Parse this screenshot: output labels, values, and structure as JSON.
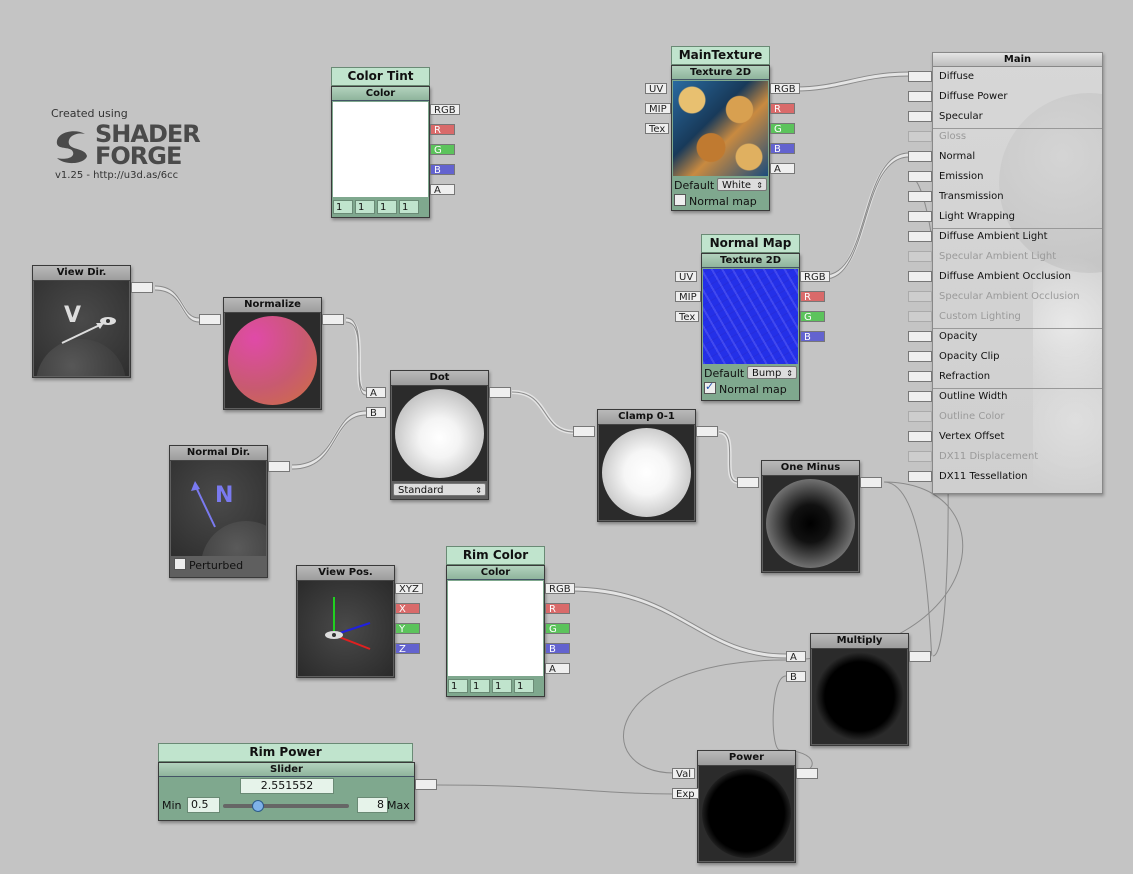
{
  "logo": {
    "created": "Created using",
    "brand_top": "SHADER",
    "brand_bottom": "FORGE",
    "version": "v1.25 - http://u3d.as/6cc"
  },
  "nodes": {
    "color_tint": {
      "title": "Color Tint",
      "sub": "Color",
      "ports": [
        "RGB",
        "R",
        "G",
        "B",
        "A"
      ],
      "values": [
        "1",
        "1",
        "1",
        "1"
      ]
    },
    "main_texture": {
      "title": "MainTexture",
      "sub": "Texture 2D",
      "inputs": [
        "UV",
        "MIP",
        "Tex"
      ],
      "ports": [
        "RGB",
        "R",
        "G",
        "B",
        "A"
      ],
      "default_label": "Default",
      "default_value": "White",
      "normal_map": "Normal map"
    },
    "normal_map": {
      "title": "Normal Map",
      "sub": "Texture 2D",
      "inputs": [
        "UV",
        "MIP",
        "Tex"
      ],
      "ports": [
        "RGB",
        "R",
        "G",
        "B"
      ],
      "default_label": "Default",
      "default_value": "Bump",
      "normal_map": "Normal map"
    },
    "view_dir": {
      "title": "View Dir.",
      "glyph": "V"
    },
    "normalize": {
      "title": "Normalize"
    },
    "dot": {
      "title": "Dot",
      "inputs": [
        "A",
        "B"
      ],
      "mode": "Standard"
    },
    "normal_dir": {
      "title": "Normal Dir.",
      "glyph": "N",
      "perturbed": "Perturbed"
    },
    "clamp": {
      "title": "Clamp 0-1"
    },
    "one_minus": {
      "title": "One Minus"
    },
    "view_pos": {
      "title": "View Pos.",
      "ports": [
        "XYZ",
        "X",
        "Y",
        "Z"
      ]
    },
    "rim_color": {
      "title": "Rim Color",
      "sub": "Color",
      "ports": [
        "RGB",
        "R",
        "G",
        "B",
        "A"
      ],
      "values": [
        "1",
        "1",
        "1",
        "1"
      ]
    },
    "multiply": {
      "title": "Multiply",
      "inputs": [
        "A",
        "B"
      ]
    },
    "power": {
      "title": "Power",
      "inputs": [
        "Val",
        "Exp"
      ]
    },
    "rim_power": {
      "title": "Rim Power",
      "sub": "Slider",
      "value": "2.551552",
      "min_label": "Min",
      "min": "0.5",
      "max": "8",
      "max_label": "Max",
      "fraction": 0.27
    }
  },
  "main": {
    "title": "Main",
    "inputs": [
      {
        "label": "Diffuse",
        "enabled": true
      },
      {
        "label": "Diffuse Power",
        "enabled": true
      },
      {
        "label": "Specular",
        "enabled": true
      },
      {
        "label": "Gloss",
        "enabled": false
      },
      {
        "label": "Normal",
        "enabled": true
      },
      {
        "label": "Emission",
        "enabled": true
      },
      {
        "label": "Transmission",
        "enabled": true
      },
      {
        "label": "Light Wrapping",
        "enabled": true
      },
      {
        "label": "Diffuse Ambient Light",
        "enabled": true
      },
      {
        "label": "Specular Ambient Light",
        "enabled": false
      },
      {
        "label": "Diffuse Ambient Occlusion",
        "enabled": true
      },
      {
        "label": "Specular Ambient Occlusion",
        "enabled": false
      },
      {
        "label": "Custom Lighting",
        "enabled": false
      },
      {
        "label": "Opacity",
        "enabled": true
      },
      {
        "label": "Opacity Clip",
        "enabled": true
      },
      {
        "label": "Refraction",
        "enabled": true
      },
      {
        "label": "Outline Width",
        "enabled": true
      },
      {
        "label": "Outline Color",
        "enabled": false
      },
      {
        "label": "Vertex Offset",
        "enabled": true
      },
      {
        "label": "DX11 Displacement",
        "enabled": false
      },
      {
        "label": "DX11 Tessellation",
        "enabled": true
      }
    ]
  }
}
